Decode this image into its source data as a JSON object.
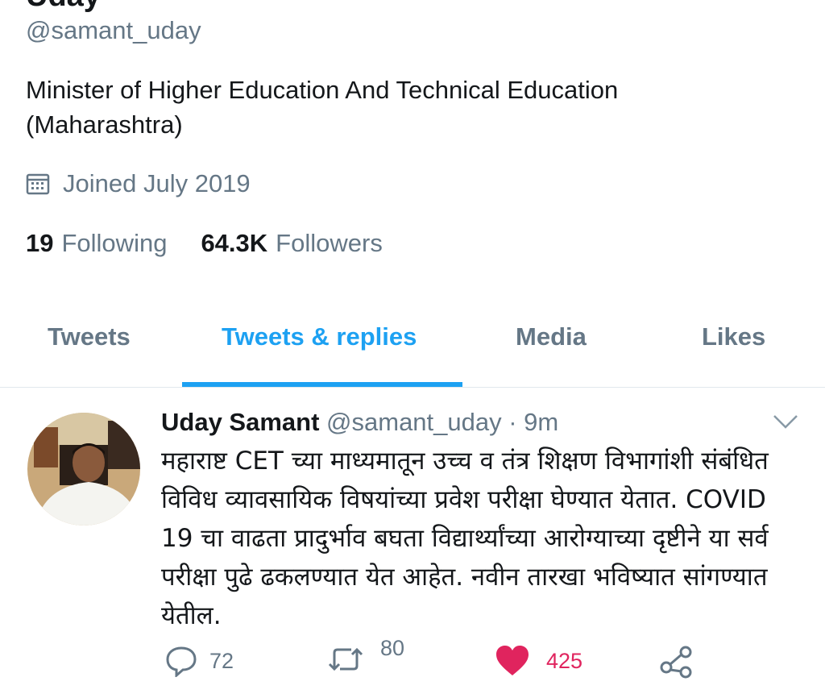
{
  "profile": {
    "name_partial": "Uday",
    "handle": "@samant_uday",
    "bio_line1": "Minister of Higher Education And Technical Education",
    "bio_line2": "(Maharashtra)",
    "joined": "Joined July 2019",
    "following_count": "19",
    "following_label": "Following",
    "followers_count": "64.3K",
    "followers_label": "Followers"
  },
  "tabs": [
    {
      "label": "Tweets"
    },
    {
      "label": "Tweets & replies"
    },
    {
      "label": "Media"
    },
    {
      "label": "Likes"
    }
  ],
  "tweet": {
    "author": "Uday Samant",
    "handle": "@samant_uday",
    "time": "· 9m",
    "lines": [
      "महाराष्ट CET च्या माध्यमातून उच्च व तंत्र शिक्षण विभागांशी संबंधित",
      "विविध व्यावसायिक विषयांच्या प्रवेश परीक्षा घेण्यात येतात. COVID",
      "19 चा वाढता प्रादुर्भाव बघता विद्यार्थ्यांच्या आरोग्याच्या  दृष्टीने या सर्व",
      "परीक्षा पुढे ढकलण्यात येत आहेत. नवीन तारखा भविष्यात सांगण्यात",
      "येतील."
    ],
    "replies": "72",
    "retweets": "80",
    "likes": "425"
  },
  "colors": {
    "accent": "#1da1f2",
    "muted": "#657786",
    "like": "#e0245e"
  },
  "icons": {
    "calendar": "calendar-icon",
    "caret": "chevron-down-icon",
    "reply": "reply-icon",
    "retweet": "retweet-icon",
    "like": "heart-icon",
    "share": "share-icon"
  }
}
